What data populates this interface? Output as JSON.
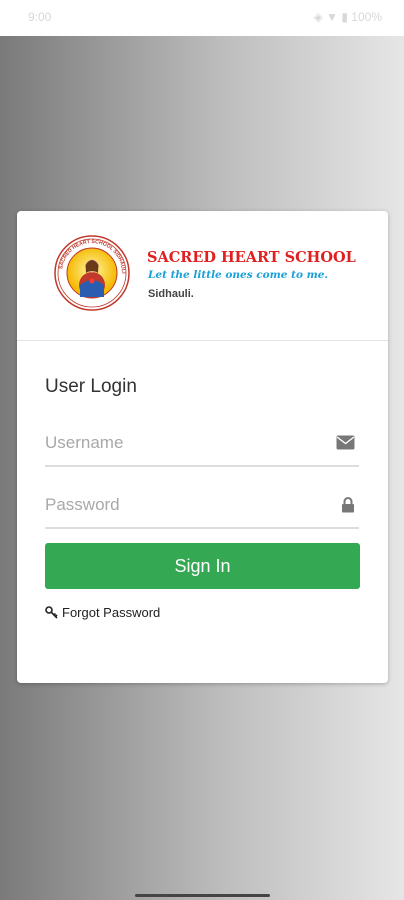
{
  "status_bar": {
    "time": "9:00",
    "icons": "◈ ▼ ▮ 100%"
  },
  "header": {
    "school_name": "SACRED HEART SCHOOL",
    "motto": "Let the little ones come to me.",
    "place": "Sidhauli.",
    "logo_ring_text": "SACRED HEART SCHOOL SIDHAULI"
  },
  "login": {
    "title": "User Login",
    "username_placeholder": "Username",
    "username_value": "",
    "password_placeholder": "Password",
    "password_value": "",
    "signin_label": "Sign In",
    "forgot_label": "Forgot Password"
  },
  "colors": {
    "accent_green": "#34a853",
    "school_red": "#e02020",
    "motto_blue": "#1aa0d8"
  },
  "icons": {
    "username": "envelope-icon",
    "password": "lock-icon",
    "forgot": "key-icon"
  }
}
